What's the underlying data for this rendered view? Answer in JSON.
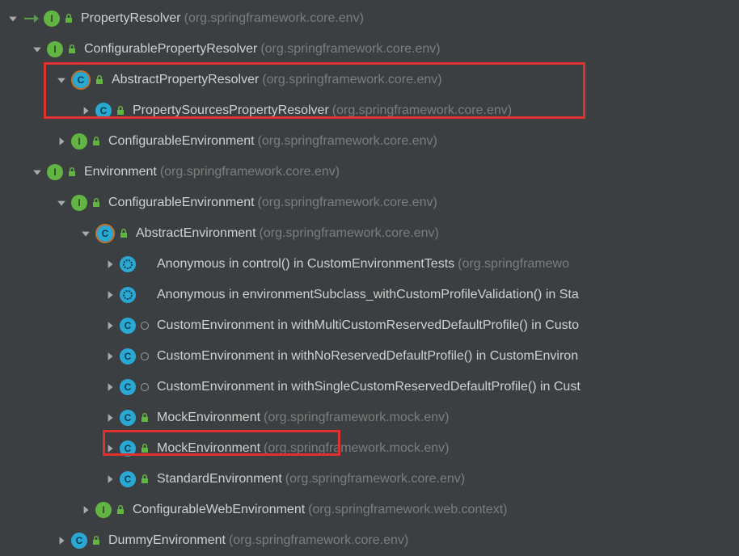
{
  "nodes": [
    {
      "indent": 10,
      "arrow": "down",
      "rootarrow": true,
      "icon": "interface",
      "impl": "closed",
      "name": "PropertyResolver",
      "pkg": "(org.springframework.core.env)"
    },
    {
      "indent": 40,
      "arrow": "down",
      "icon": "interface",
      "impl": "closed",
      "name": "ConfigurablePropertyResolver",
      "pkg": "(org.springframework.core.env)"
    },
    {
      "indent": 70,
      "arrow": "down",
      "icon": "abstract-class",
      "impl": "closed",
      "name": "AbstractPropertyResolver",
      "pkg": "(org.springframework.core.env)"
    },
    {
      "indent": 100,
      "arrow": "right",
      "icon": "class",
      "impl": "closed",
      "name": "PropertySourcesPropertyResolver",
      "pkg": "(org.springframework.core.env)"
    },
    {
      "indent": 70,
      "arrow": "right",
      "icon": "interface",
      "impl": "closed",
      "name": "ConfigurableEnvironment",
      "pkg": "(org.springframework.core.env)"
    },
    {
      "indent": 40,
      "arrow": "down",
      "icon": "interface",
      "impl": "closed",
      "name": "Environment",
      "pkg": "(org.springframework.core.env)"
    },
    {
      "indent": 70,
      "arrow": "down",
      "icon": "interface",
      "impl": "closed",
      "name": "ConfigurableEnvironment",
      "pkg": "(org.springframework.core.env)"
    },
    {
      "indent": 100,
      "arrow": "down",
      "icon": "abstract-class",
      "impl": "closed",
      "name": "AbstractEnvironment",
      "pkg": "(org.springframework.core.env)"
    },
    {
      "indent": 130,
      "arrow": "right",
      "icon": "anon",
      "impl": "none",
      "name": "Anonymous in control() in CustomEnvironmentTests",
      "pkg": "(org.springframewo"
    },
    {
      "indent": 130,
      "arrow": "right",
      "icon": "anon",
      "impl": "none",
      "name": "Anonymous in environmentSubclass_withCustomProfileValidation() in Sta",
      "pkg": ""
    },
    {
      "indent": 130,
      "arrow": "right",
      "icon": "class",
      "impl": "circle",
      "name": "CustomEnvironment in withMultiCustomReservedDefaultProfile() in Custo",
      "pkg": ""
    },
    {
      "indent": 130,
      "arrow": "right",
      "icon": "class",
      "impl": "circle",
      "name": "CustomEnvironment in withNoReservedDefaultProfile() in CustomEnviron",
      "pkg": ""
    },
    {
      "indent": 130,
      "arrow": "right",
      "icon": "class",
      "impl": "circle",
      "name": "CustomEnvironment in withSingleCustomReservedDefaultProfile() in Cust",
      "pkg": ""
    },
    {
      "indent": 130,
      "arrow": "right",
      "icon": "class",
      "impl": "closed",
      "name": "MockEnvironment",
      "pkg": "(org.springframework.mock.env)"
    },
    {
      "indent": 130,
      "arrow": "right",
      "icon": "class",
      "impl": "closed",
      "name": "MockEnvironment",
      "pkg": "(org.springframework.mock.env)"
    },
    {
      "indent": 130,
      "arrow": "right",
      "icon": "class",
      "impl": "closed",
      "name": "StandardEnvironment",
      "pkg": "(org.springframework.core.env)"
    },
    {
      "indent": 100,
      "arrow": "right",
      "icon": "interface",
      "impl": "closed",
      "name": "ConfigurableWebEnvironment",
      "pkg": "(org.springframework.web.context)"
    },
    {
      "indent": 70,
      "arrow": "right",
      "icon": "class",
      "impl": "closed",
      "name": "DummyEnvironment",
      "pkg": "(org.springframework.core.env)"
    }
  ]
}
